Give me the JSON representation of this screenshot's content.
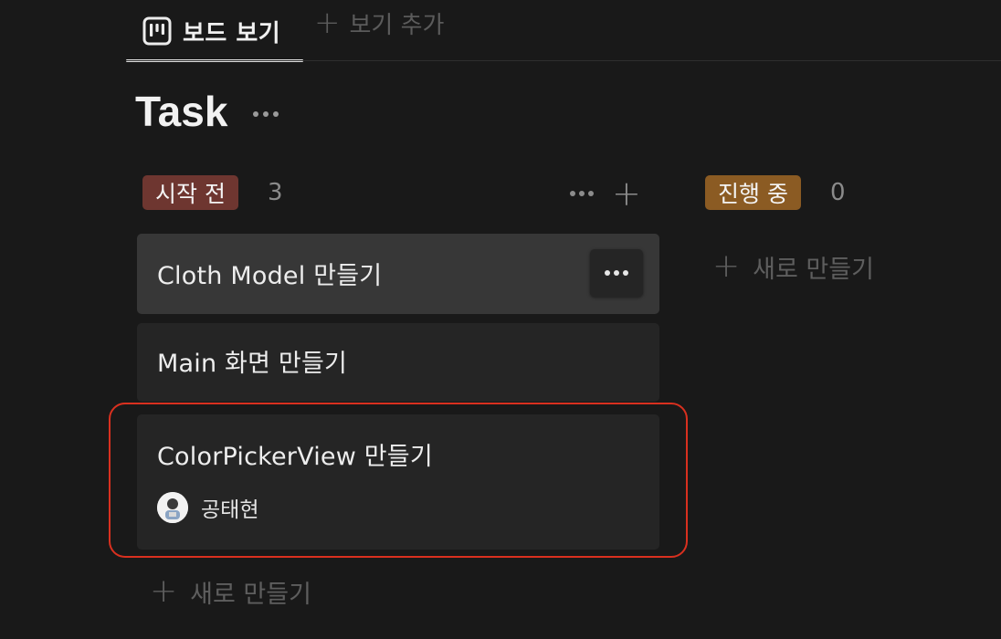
{
  "tabs": {
    "active_label": "보드 보기",
    "add_view_label": "보기 추가"
  },
  "database": {
    "title": "Task"
  },
  "columns": [
    {
      "status": "시작 전",
      "count": "3",
      "color": "#6e3630",
      "cards": [
        {
          "title": "Cloth Model 만들기"
        },
        {
          "title": "Main 화면 만들기"
        },
        {
          "title": "ColorPickerView 만들기",
          "assignee": "공태현"
        }
      ],
      "new_label": "새로 만들기"
    },
    {
      "status": "진행 중",
      "count": "0",
      "color": "#8b5b23",
      "new_label": "새로 만들기"
    }
  ],
  "colors": {
    "background": "#191919",
    "card": "#252525",
    "card_hover": "#373737",
    "highlight": "#d9301f"
  },
  "icons": {
    "tab": "board-view-icon",
    "add": "plus-icon",
    "more": "more-dots-icon"
  }
}
